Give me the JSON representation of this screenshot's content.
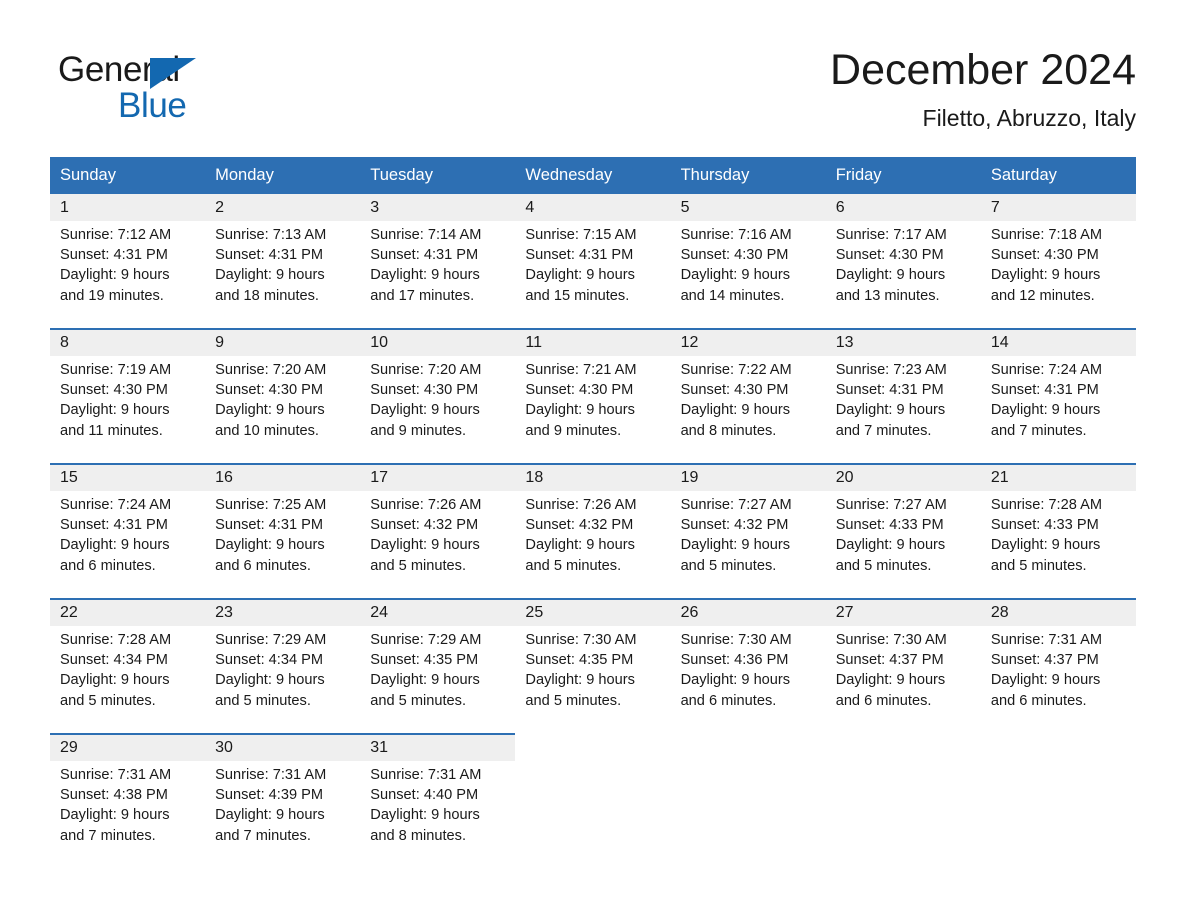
{
  "brand": {
    "name_part1": "General",
    "name_part2": "Blue",
    "triangle_color": "#1368b0"
  },
  "header": {
    "title": "December 2024",
    "subtitle": "Filetto, Abruzzo, Italy"
  },
  "theme": {
    "header_bg": "#2d6fb3",
    "daynum_bg": "#efefef",
    "text": "#1a1a1a",
    "page_bg": "#ffffff"
  },
  "weekdays": [
    "Sunday",
    "Monday",
    "Tuesday",
    "Wednesday",
    "Thursday",
    "Friday",
    "Saturday"
  ],
  "labels": {
    "sunrise_prefix": "Sunrise:",
    "sunset_prefix": "Sunset:",
    "daylight_prefix": "Daylight:"
  },
  "weeks": [
    {
      "days": [
        {
          "num": "1",
          "l1": "Sunrise: 7:12 AM",
          "l2": "Sunset: 4:31 PM",
          "l3": "Daylight: 9 hours",
          "l4": "and 19 minutes."
        },
        {
          "num": "2",
          "l1": "Sunrise: 7:13 AM",
          "l2": "Sunset: 4:31 PM",
          "l3": "Daylight: 9 hours",
          "l4": "and 18 minutes."
        },
        {
          "num": "3",
          "l1": "Sunrise: 7:14 AM",
          "l2": "Sunset: 4:31 PM",
          "l3": "Daylight: 9 hours",
          "l4": "and 17 minutes."
        },
        {
          "num": "4",
          "l1": "Sunrise: 7:15 AM",
          "l2": "Sunset: 4:31 PM",
          "l3": "Daylight: 9 hours",
          "l4": "and 15 minutes."
        },
        {
          "num": "5",
          "l1": "Sunrise: 7:16 AM",
          "l2": "Sunset: 4:30 PM",
          "l3": "Daylight: 9 hours",
          "l4": "and 14 minutes."
        },
        {
          "num": "6",
          "l1": "Sunrise: 7:17 AM",
          "l2": "Sunset: 4:30 PM",
          "l3": "Daylight: 9 hours",
          "l4": "and 13 minutes."
        },
        {
          "num": "7",
          "l1": "Sunrise: 7:18 AM",
          "l2": "Sunset: 4:30 PM",
          "l3": "Daylight: 9 hours",
          "l4": "and 12 minutes."
        }
      ]
    },
    {
      "days": [
        {
          "num": "8",
          "l1": "Sunrise: 7:19 AM",
          "l2": "Sunset: 4:30 PM",
          "l3": "Daylight: 9 hours",
          "l4": "and 11 minutes."
        },
        {
          "num": "9",
          "l1": "Sunrise: 7:20 AM",
          "l2": "Sunset: 4:30 PM",
          "l3": "Daylight: 9 hours",
          "l4": "and 10 minutes."
        },
        {
          "num": "10",
          "l1": "Sunrise: 7:20 AM",
          "l2": "Sunset: 4:30 PM",
          "l3": "Daylight: 9 hours",
          "l4": "and 9 minutes."
        },
        {
          "num": "11",
          "l1": "Sunrise: 7:21 AM",
          "l2": "Sunset: 4:30 PM",
          "l3": "Daylight: 9 hours",
          "l4": "and 9 minutes."
        },
        {
          "num": "12",
          "l1": "Sunrise: 7:22 AM",
          "l2": "Sunset: 4:30 PM",
          "l3": "Daylight: 9 hours",
          "l4": "and 8 minutes."
        },
        {
          "num": "13",
          "l1": "Sunrise: 7:23 AM",
          "l2": "Sunset: 4:31 PM",
          "l3": "Daylight: 9 hours",
          "l4": "and 7 minutes."
        },
        {
          "num": "14",
          "l1": "Sunrise: 7:24 AM",
          "l2": "Sunset: 4:31 PM",
          "l3": "Daylight: 9 hours",
          "l4": "and 7 minutes."
        }
      ]
    },
    {
      "days": [
        {
          "num": "15",
          "l1": "Sunrise: 7:24 AM",
          "l2": "Sunset: 4:31 PM",
          "l3": "Daylight: 9 hours",
          "l4": "and 6 minutes."
        },
        {
          "num": "16",
          "l1": "Sunrise: 7:25 AM",
          "l2": "Sunset: 4:31 PM",
          "l3": "Daylight: 9 hours",
          "l4": "and 6 minutes."
        },
        {
          "num": "17",
          "l1": "Sunrise: 7:26 AM",
          "l2": "Sunset: 4:32 PM",
          "l3": "Daylight: 9 hours",
          "l4": "and 5 minutes."
        },
        {
          "num": "18",
          "l1": "Sunrise: 7:26 AM",
          "l2": "Sunset: 4:32 PM",
          "l3": "Daylight: 9 hours",
          "l4": "and 5 minutes."
        },
        {
          "num": "19",
          "l1": "Sunrise: 7:27 AM",
          "l2": "Sunset: 4:32 PM",
          "l3": "Daylight: 9 hours",
          "l4": "and 5 minutes."
        },
        {
          "num": "20",
          "l1": "Sunrise: 7:27 AM",
          "l2": "Sunset: 4:33 PM",
          "l3": "Daylight: 9 hours",
          "l4": "and 5 minutes."
        },
        {
          "num": "21",
          "l1": "Sunrise: 7:28 AM",
          "l2": "Sunset: 4:33 PM",
          "l3": "Daylight: 9 hours",
          "l4": "and 5 minutes."
        }
      ]
    },
    {
      "days": [
        {
          "num": "22",
          "l1": "Sunrise: 7:28 AM",
          "l2": "Sunset: 4:34 PM",
          "l3": "Daylight: 9 hours",
          "l4": "and 5 minutes."
        },
        {
          "num": "23",
          "l1": "Sunrise: 7:29 AM",
          "l2": "Sunset: 4:34 PM",
          "l3": "Daylight: 9 hours",
          "l4": "and 5 minutes."
        },
        {
          "num": "24",
          "l1": "Sunrise: 7:29 AM",
          "l2": "Sunset: 4:35 PM",
          "l3": "Daylight: 9 hours",
          "l4": "and 5 minutes."
        },
        {
          "num": "25",
          "l1": "Sunrise: 7:30 AM",
          "l2": "Sunset: 4:35 PM",
          "l3": "Daylight: 9 hours",
          "l4": "and 5 minutes."
        },
        {
          "num": "26",
          "l1": "Sunrise: 7:30 AM",
          "l2": "Sunset: 4:36 PM",
          "l3": "Daylight: 9 hours",
          "l4": "and 6 minutes."
        },
        {
          "num": "27",
          "l1": "Sunrise: 7:30 AM",
          "l2": "Sunset: 4:37 PM",
          "l3": "Daylight: 9 hours",
          "l4": "and 6 minutes."
        },
        {
          "num": "28",
          "l1": "Sunrise: 7:31 AM",
          "l2": "Sunset: 4:37 PM",
          "l3": "Daylight: 9 hours",
          "l4": "and 6 minutes."
        }
      ]
    },
    {
      "days": [
        {
          "num": "29",
          "l1": "Sunrise: 7:31 AM",
          "l2": "Sunset: 4:38 PM",
          "l3": "Daylight: 9 hours",
          "l4": "and 7 minutes."
        },
        {
          "num": "30",
          "l1": "Sunrise: 7:31 AM",
          "l2": "Sunset: 4:39 PM",
          "l3": "Daylight: 9 hours",
          "l4": "and 7 minutes."
        },
        {
          "num": "31",
          "l1": "Sunrise: 7:31 AM",
          "l2": "Sunset: 4:40 PM",
          "l3": "Daylight: 9 hours",
          "l4": "and 8 minutes."
        },
        {
          "num": "",
          "l1": "",
          "l2": "",
          "l3": "",
          "l4": ""
        },
        {
          "num": "",
          "l1": "",
          "l2": "",
          "l3": "",
          "l4": ""
        },
        {
          "num": "",
          "l1": "",
          "l2": "",
          "l3": "",
          "l4": ""
        },
        {
          "num": "",
          "l1": "",
          "l2": "",
          "l3": "",
          "l4": ""
        }
      ]
    }
  ]
}
